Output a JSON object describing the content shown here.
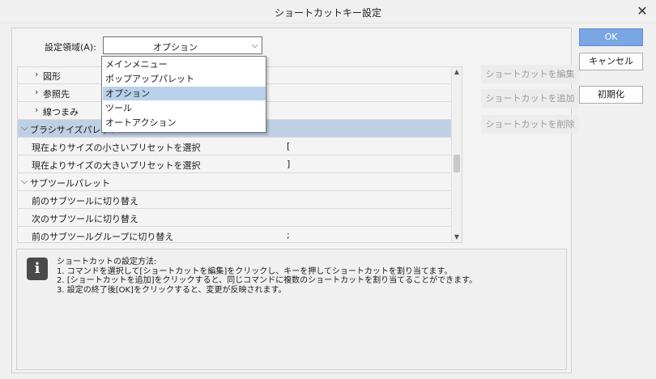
{
  "window": {
    "title": "ショートカットキー設定",
    "close_glyph": "✕"
  },
  "area": {
    "label": "設定領域(A):",
    "value": "オプション"
  },
  "dropdown": {
    "options": [
      "メインメニュー",
      "ポップアップパレット",
      "オプション",
      "ツール",
      "オートアクション"
    ],
    "selected_index": 2
  },
  "tree": {
    "rows": [
      {
        "label": "図形",
        "key": "",
        "kind": "child-group"
      },
      {
        "label": "参照先",
        "key": "",
        "kind": "child-group"
      },
      {
        "label": "線つまみ",
        "key": "",
        "kind": "child-group"
      },
      {
        "label": "ブラシサイズパレット",
        "key": "",
        "kind": "group",
        "selected": true
      },
      {
        "label": "現在よりサイズの小さいプリセットを選択",
        "key": "[",
        "kind": "item"
      },
      {
        "label": "現在よりサイズの大きいプリセットを選択",
        "key": "]",
        "kind": "item"
      },
      {
        "label": "サブツールパレット",
        "key": "",
        "kind": "group"
      },
      {
        "label": "前のサブツールに切り替え",
        "key": "",
        "kind": "item"
      },
      {
        "label": "次のサブツールに切り替え",
        "key": "",
        "kind": "item"
      },
      {
        "label": "前のサブツールグループに切り替え",
        "key": ";",
        "kind": "item"
      }
    ]
  },
  "side_buttons": {
    "edit": "ショートカットを編集",
    "add": "ショートカットを追加",
    "delete": "ショートカットを削除"
  },
  "info": {
    "icon": "i",
    "lines": [
      "ショートカットの設定方法:",
      "1. コマンドを選択して[ショートカットを編集]をクリックし、キーを押してショートカットを割り当てます。",
      "2. [ショートカットを追加]をクリックすると、同じコマンドに複数のショートカットを割り当てることができます。",
      "3. 設定の終了後[OK]をクリックすると、変更が反映されます。"
    ]
  },
  "buttons": {
    "ok": "OK",
    "cancel": "キャンセル",
    "reset": "初期化"
  },
  "colors": {
    "accent": "#7aa6e3",
    "selection": "#bfd0e4"
  }
}
